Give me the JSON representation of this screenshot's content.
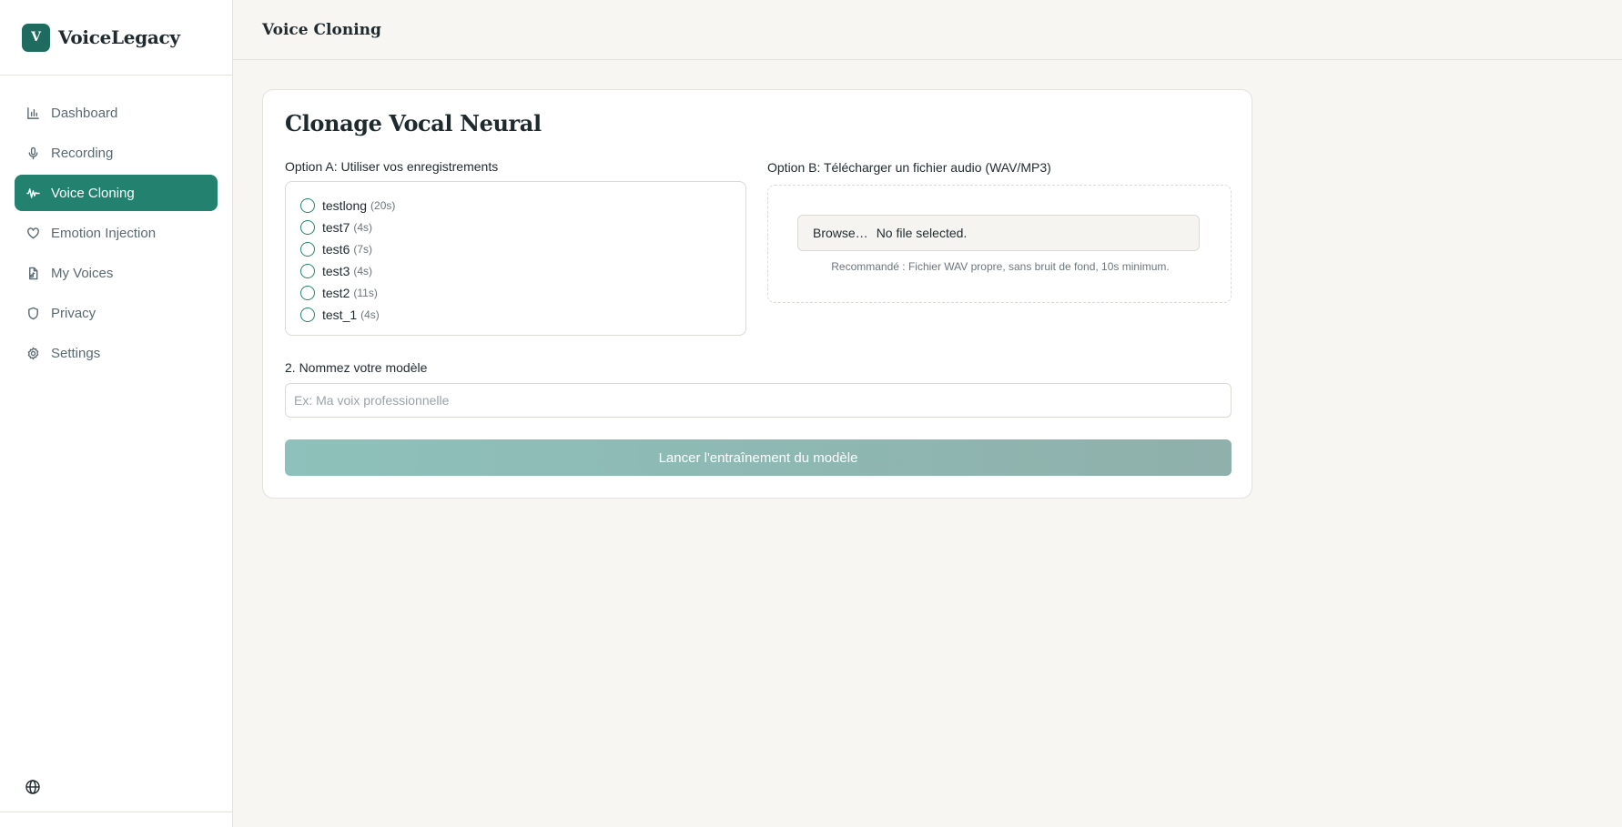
{
  "brand": {
    "logo_letter": "V",
    "name": "VoiceLegacy"
  },
  "sidebar": {
    "items": [
      {
        "label": "Dashboard",
        "icon": "bar-chart-icon",
        "active": false
      },
      {
        "label": "Recording",
        "icon": "microphone-icon",
        "active": false
      },
      {
        "label": "Voice Cloning",
        "icon": "audio-waveform-icon",
        "active": true
      },
      {
        "label": "Emotion Injection",
        "icon": "heart-icon",
        "active": false
      },
      {
        "label": "My Voices",
        "icon": "file-audio-icon",
        "active": false
      },
      {
        "label": "Privacy",
        "icon": "shield-icon",
        "active": false
      },
      {
        "label": "Settings",
        "icon": "gear-icon",
        "active": false
      }
    ],
    "footer_icon": "globe-icon"
  },
  "header": {
    "title": "Voice Cloning"
  },
  "card": {
    "title": "Clonage Vocal Neural",
    "option_a_label": "Option A: Utiliser vos enregistrements",
    "recordings": [
      {
        "name": "testlong",
        "duration": "(20s)"
      },
      {
        "name": "test7",
        "duration": "(4s)"
      },
      {
        "name": "test6",
        "duration": "(7s)"
      },
      {
        "name": "test3",
        "duration": "(4s)"
      },
      {
        "name": "test2",
        "duration": "(11s)"
      },
      {
        "name": "test_1",
        "duration": "(4s)"
      }
    ],
    "option_b_label": "Option B: Télécharger un fichier audio (WAV/MP3)",
    "file_browse_label": "Browse…",
    "file_status": "No file selected.",
    "upload_hint": "Recommandé : Fichier WAV propre, sans bruit de fond, 10s minimum.",
    "name_label": "2. Nommez votre modèle",
    "name_placeholder": "Ex: Ma voix professionnelle",
    "name_value": "",
    "train_button_label": "Lancer l'entraînement du modèle"
  },
  "colors": {
    "accent": "#23826f",
    "logo_bg": "#1f6b60",
    "button_disabled_start": "#8ec1bb",
    "button_disabled_end": "#8fb0ab",
    "background": "#f7f6f2"
  }
}
